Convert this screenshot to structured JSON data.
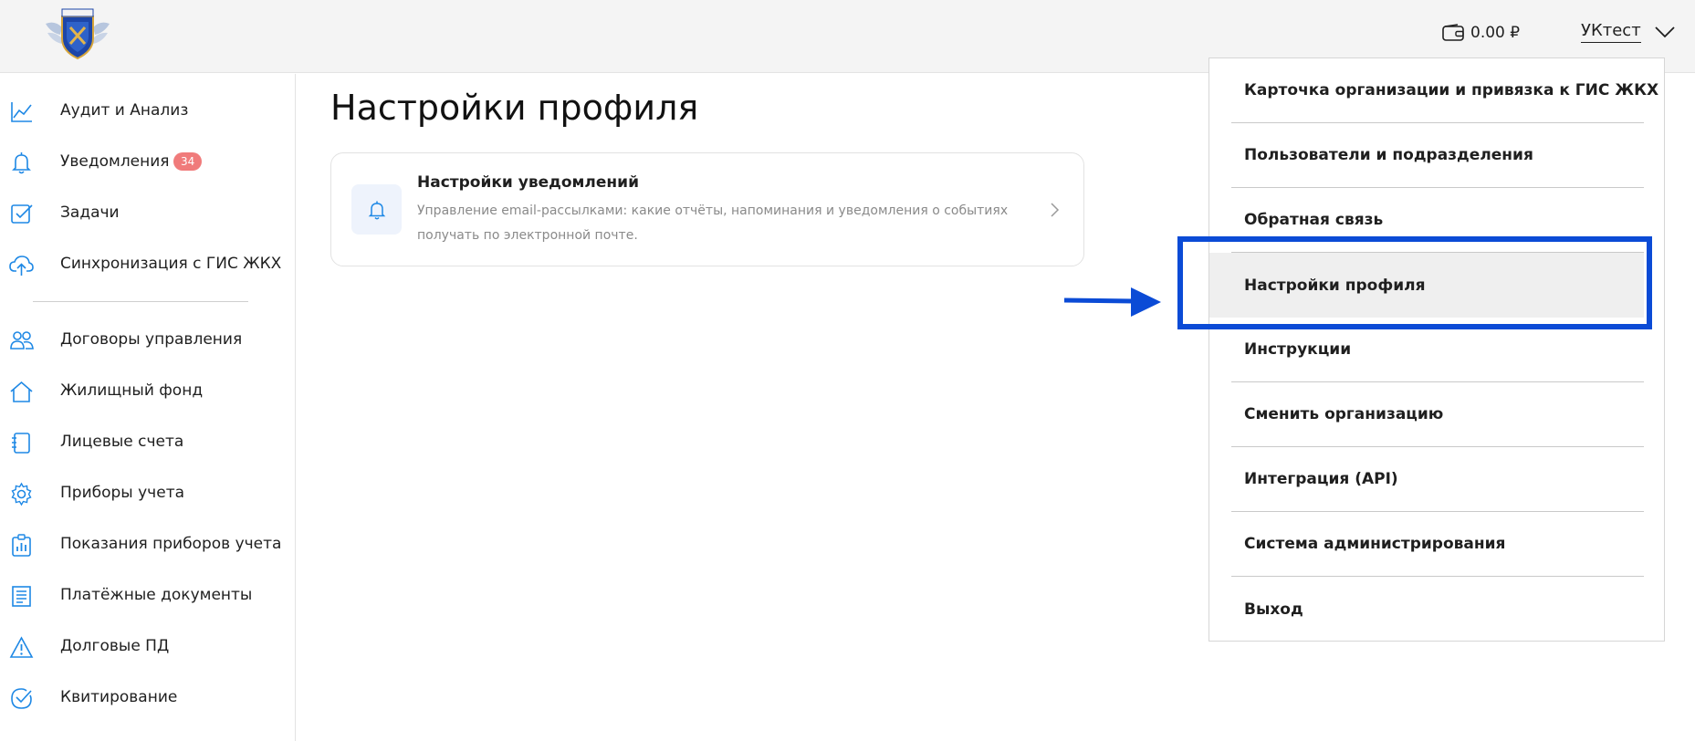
{
  "header": {
    "balance": "0.00 ₽",
    "user_name": "УКтест"
  },
  "sidebar": {
    "items": [
      {
        "label": "Аудит и Анализ",
        "icon": "chart-line-icon"
      },
      {
        "label": "Уведомления",
        "icon": "bell-icon",
        "badge": "34"
      },
      {
        "label": "Задачи",
        "icon": "checkbox-icon"
      },
      {
        "label": "Синхронизация с ГИС ЖКХ",
        "icon": "cloud-upload-icon"
      },
      {
        "label": "Договоры управления",
        "icon": "users-icon"
      },
      {
        "label": "Жилищный фонд",
        "icon": "house-icon"
      },
      {
        "label": "Лицевые счета",
        "icon": "notebook-icon"
      },
      {
        "label": "Приборы учета",
        "icon": "gear-icon"
      },
      {
        "label": "Показания приборов учета",
        "icon": "clipboard-chart-icon"
      },
      {
        "label": "Платёжные документы",
        "icon": "receipt-icon"
      },
      {
        "label": "Долговые ПД",
        "icon": "warning-triangle-icon"
      },
      {
        "label": "Квитирование",
        "icon": "check-circle-icon"
      }
    ]
  },
  "main": {
    "page_title": "Настройки профиля",
    "card": {
      "title": "Настройки уведомлений",
      "description": "Управление email-рассылками: какие отчёты, напоминания и уведомления о событиях получать по электронной почте."
    }
  },
  "dropdown": {
    "items": [
      {
        "label": "Карточка организации и привязка к ГИС ЖКХ"
      },
      {
        "label": "Пользователи и подразделения"
      },
      {
        "label": "Обратная связь"
      },
      {
        "label": "Настройки профиля",
        "active": true
      },
      {
        "label": "Инструкции"
      },
      {
        "label": "Сменить организацию"
      },
      {
        "label": "Интеграция (API)"
      },
      {
        "label": "Система администрирования"
      },
      {
        "label": "Выход"
      }
    ]
  },
  "colors": {
    "accent": "#1e88e5",
    "highlight_box": "#0b4bd6",
    "badge": "#f07b7b"
  }
}
